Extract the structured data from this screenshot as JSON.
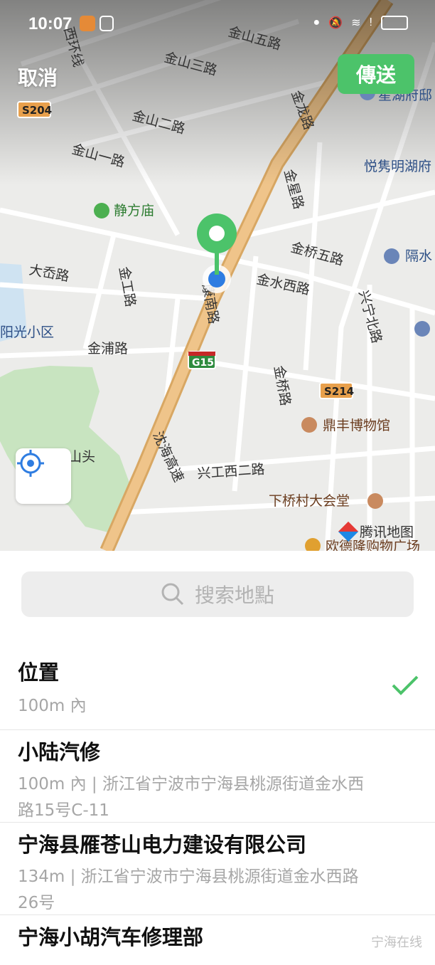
{
  "status_bar": {
    "time": "10:07"
  },
  "header": {
    "cancel_label": "取消",
    "send_label": "傳送"
  },
  "map": {
    "labels": {
      "xihuan": "西环线",
      "s204": "S204",
      "jinshan5": "金山五路",
      "jinshan3": "金山三路",
      "jinshan2": "金山二路",
      "jinshan1": "金山一路",
      "jinlong": "金龙路",
      "xinghu": "星湖府邸",
      "yuejuan": "悦隽明湖府",
      "jingfang": "静方庙",
      "jinxing": "金星路",
      "jinqiao5": "金桥五路",
      "geshui": "隔水",
      "daqi": "大岙路",
      "jingong": "金工路",
      "kang": "康南路",
      "jinshui": "金水西路",
      "xingning": "兴宁北路",
      "yangguang": "阳光小区",
      "jinpu": "金浦路",
      "g15": "G15",
      "jinqiao": "金桥路",
      "s214": "S214",
      "dingfeng": "鼎丰博物馆",
      "shanhai": "沈海高速",
      "shantou": "山头",
      "xinggong": "兴工西二路",
      "xiaqiao": "下桥村大会堂",
      "tencent": "腾讯地图",
      "oude": "欧德隆购物广场"
    }
  },
  "search": {
    "placeholder": "搜索地點"
  },
  "places": [
    {
      "title": "位置",
      "subtitle": "100m 內",
      "selected": true
    },
    {
      "title": "小陆汽修",
      "subtitle": "100m 內 | 浙江省宁波市宁海县桃源街道金水西路15号C-11"
    },
    {
      "title": "宁海县雁苍山电力建设有限公司",
      "subtitle": "134m | 浙江省宁波市宁海县桃源街道金水西路26号"
    },
    {
      "title": "宁海小胡汽车修理部",
      "subtitle": ""
    }
  ],
  "watermark": "宁海在线",
  "colors": {
    "accent": "#4cc36a",
    "pin_blue": "#2f7de1",
    "highway": "#e7b877"
  }
}
